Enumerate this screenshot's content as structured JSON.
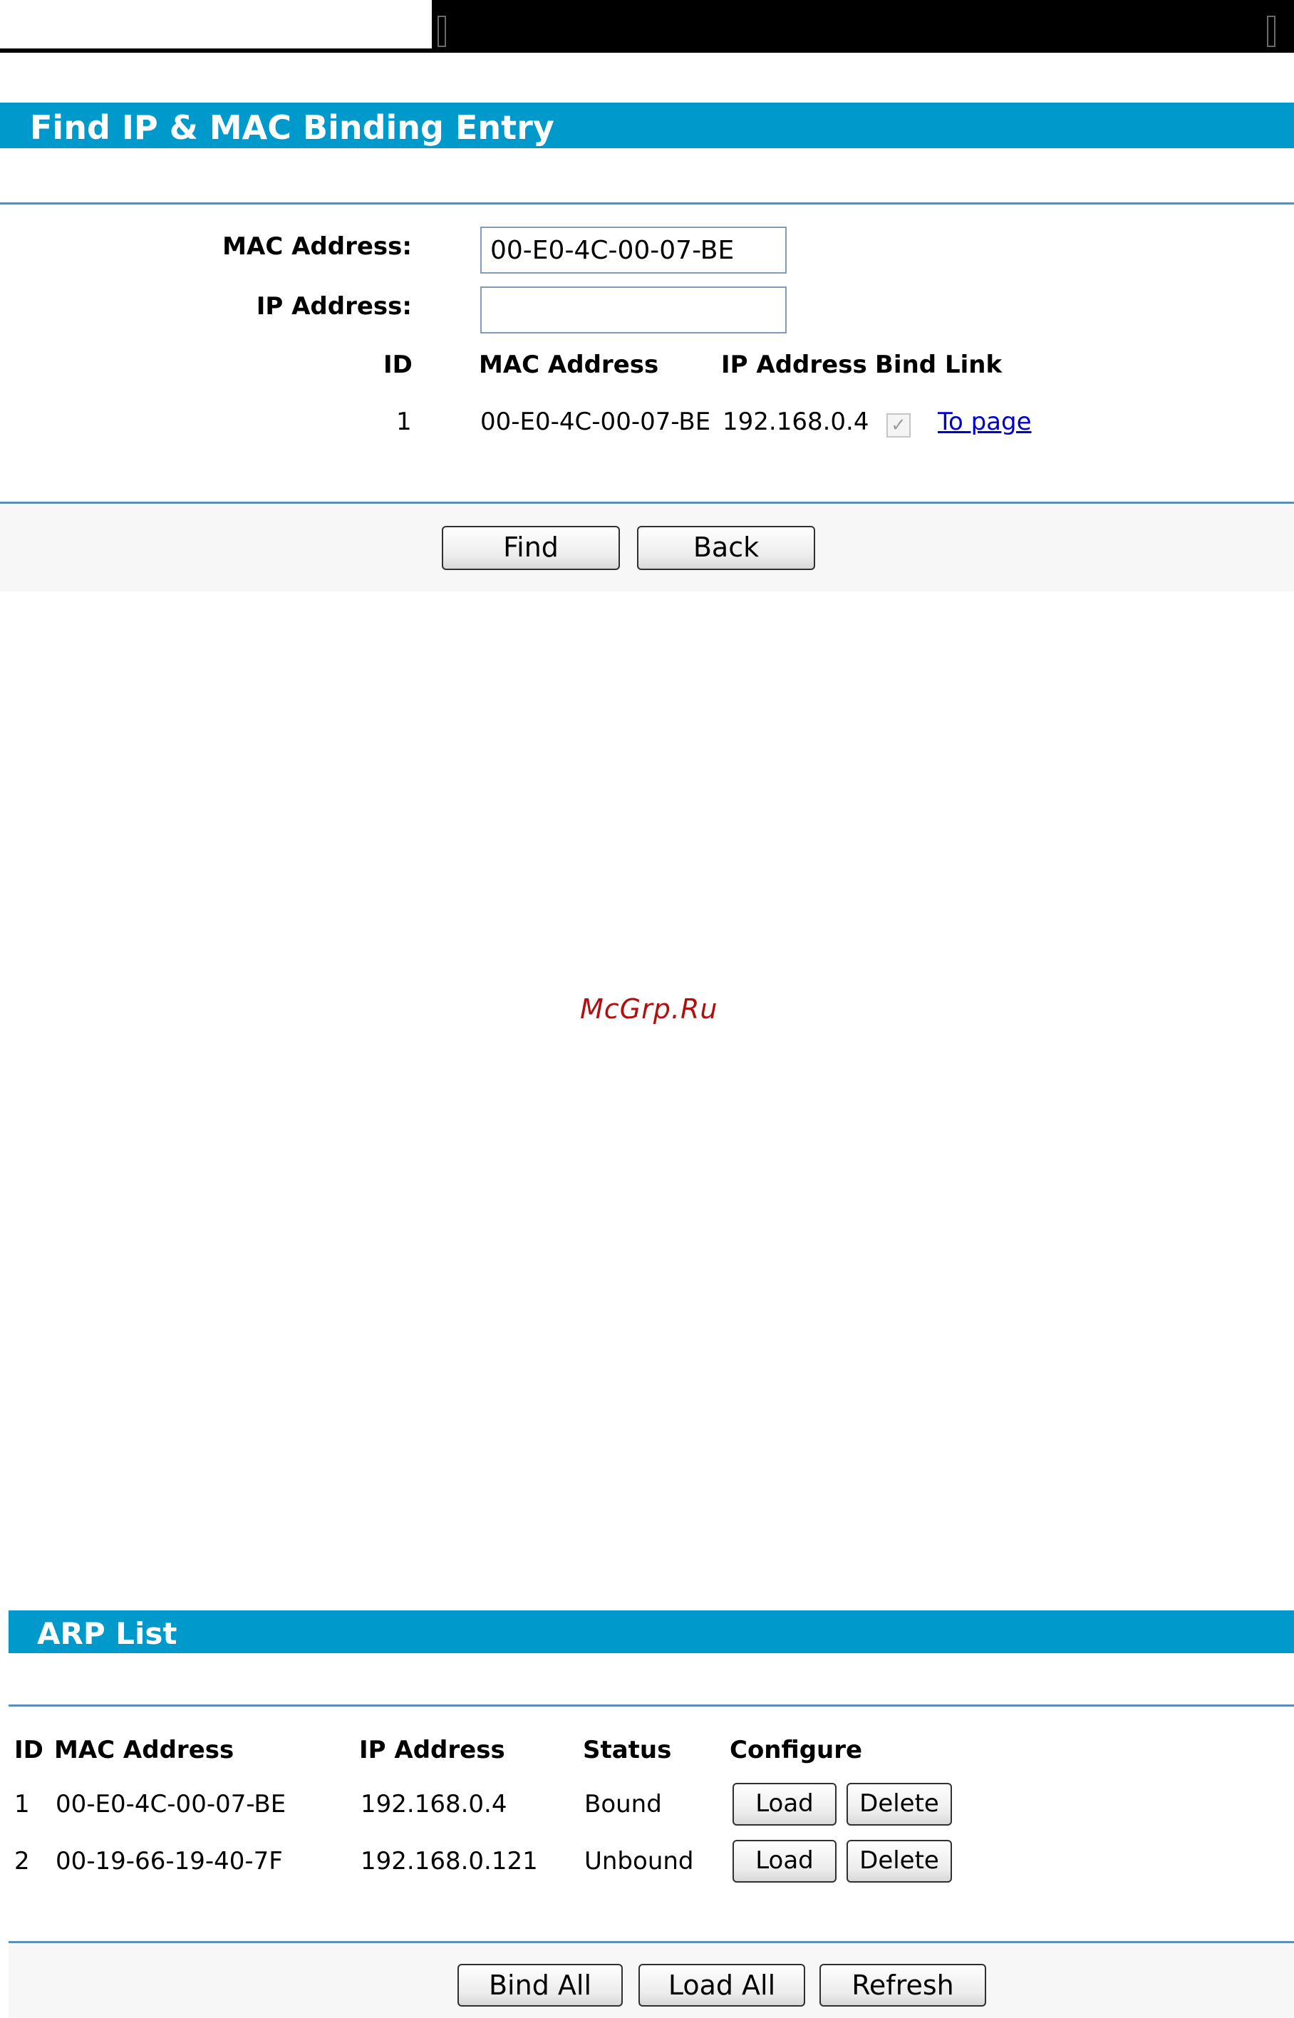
{
  "find_section": {
    "title": "Find IP & MAC Binding Entry",
    "mac_label": "MAC Address:",
    "mac_value": "00-E0-4C-00-07-BE",
    "ip_label": "IP Address:",
    "ip_value": "",
    "result_headers": {
      "id": "ID",
      "mac": "MAC Address",
      "ip": "IP Address",
      "bind": "Bind Link"
    },
    "results": [
      {
        "id": "1",
        "mac": "00-E0-4C-00-07-BE",
        "ip": "192.168.0.4",
        "bound": true,
        "link": "To page"
      }
    ],
    "buttons": {
      "find": "Find",
      "back": "Back"
    }
  },
  "watermark": "McGrp.Ru",
  "arp_section": {
    "title": "ARP List",
    "headers": {
      "id": "ID",
      "mac": "MAC Address",
      "ip": "IP Address",
      "status": "Status",
      "configure": "Configure"
    },
    "rows": [
      {
        "id": "1",
        "mac": "00-E0-4C-00-07-BE",
        "ip": "192.168.0.4",
        "status": "Bound",
        "load": "Load",
        "delete": "Delete"
      },
      {
        "id": "2",
        "mac": "00-19-66-19-40-7F",
        "ip": "192.168.0.121",
        "status": "Unbound",
        "load": "Load",
        "delete": "Delete"
      }
    ],
    "buttons": {
      "bind_all": "Bind All",
      "load_all": "Load All",
      "refresh": "Refresh"
    }
  },
  "colors": {
    "title_bar": "#0099cc",
    "rule": "#5c8fb4",
    "link": "#0000cc",
    "watermark": "#b01010"
  }
}
